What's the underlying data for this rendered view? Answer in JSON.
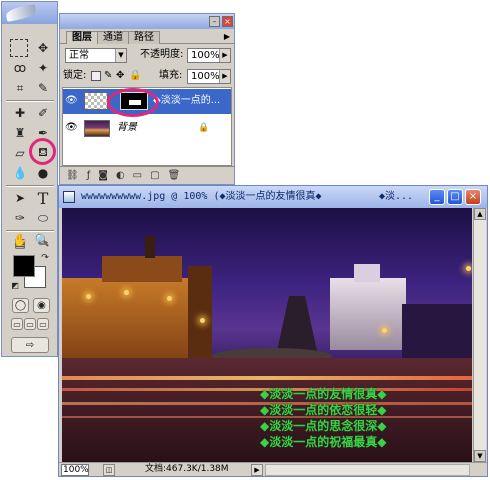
{
  "tools_palette": {
    "tools": [
      "marquee-icon",
      "move-icon",
      "lasso-icon",
      "magic-wand-icon",
      "crop-icon",
      "slice-icon",
      "healing-brush-icon",
      "brush-icon",
      "clone-stamp-icon",
      "history-brush-icon",
      "eraser-icon",
      "paint-bucket-icon",
      "blur-icon",
      "dodge-icon",
      "path-selection-icon",
      "type-icon",
      "pen-icon",
      "shape-icon",
      "notes-icon",
      "eyedropper-icon",
      "hand-icon",
      "zoom-icon"
    ],
    "type_tool_glyph": "T"
  },
  "layers_panel": {
    "tabs": [
      "图层",
      "通道",
      "路径"
    ],
    "blend_mode": "正常",
    "opacity_label": "不透明度:",
    "opacity_value": "100%",
    "lock_label": "锁定:",
    "fill_label": "填充:",
    "fill_value": "100%",
    "layers": [
      {
        "name": "◆淡淡一点的...",
        "selected": true
      },
      {
        "name": "背景",
        "selected": false
      }
    ]
  },
  "document": {
    "title": "wwwwwwwwww.jpg @ 100% (◆淡淡一点的友情很真◆",
    "title_tail": "◆淡...",
    "zoom": "100%",
    "doc_info": "文档:467.3K/1.38M",
    "overlay_lines": [
      "◆淡淡一点的友情很真◆",
      "◆淡淡一点的依恋很轻◆",
      "◆淡淡一点的思念很深◆",
      "◆淡淡一点的祝福最真◆"
    ]
  },
  "colors": {
    "highlight": "#e0287a",
    "overlay_text": "#3ecf4a",
    "title_bar": "#9db4e8"
  }
}
